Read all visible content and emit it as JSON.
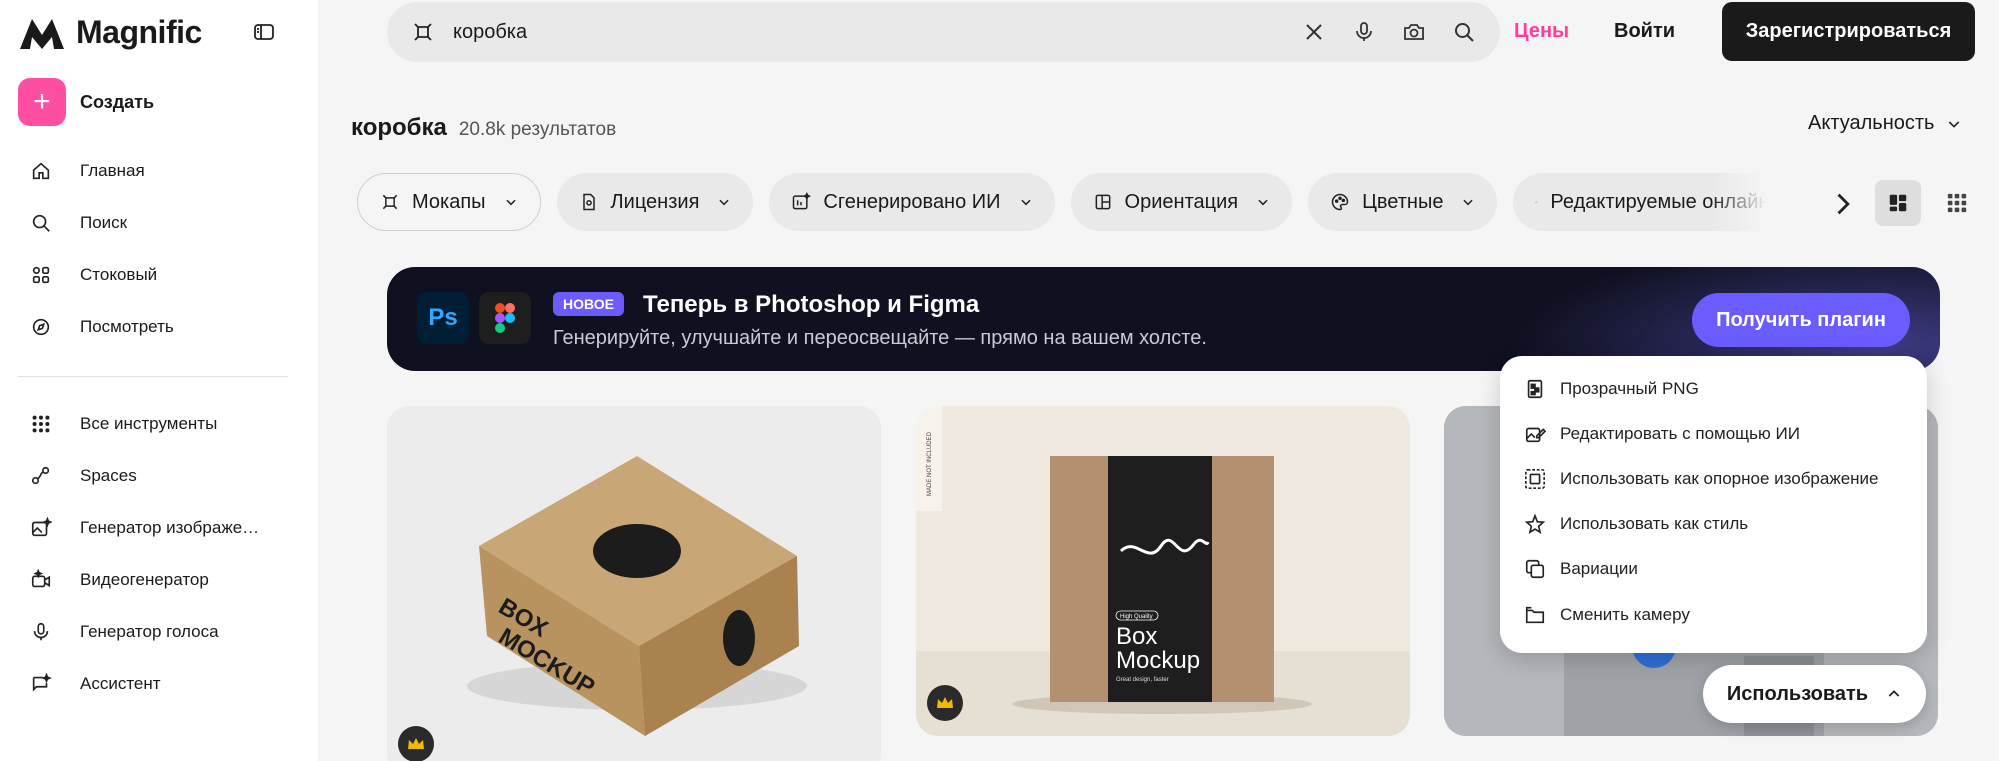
{
  "brand": {
    "name": "Magnific"
  },
  "sidebar": {
    "create_label": "Создать",
    "items_top": [
      {
        "label": "Главная",
        "icon": "home-icon"
      },
      {
        "label": "Поиск",
        "icon": "search-icon"
      },
      {
        "label": "Стоковый",
        "icon": "stock-grid-icon"
      },
      {
        "label": "Посмотреть",
        "icon": "explore-icon"
      }
    ],
    "items_bottom": [
      {
        "label": "Все инструменты",
        "icon": "apps-grid-icon"
      },
      {
        "label": "Spaces",
        "icon": "spaces-icon"
      },
      {
        "label": "Генератор изображе…",
        "icon": "image-generator-icon"
      },
      {
        "label": "Видеогенератор",
        "icon": "video-generator-icon"
      },
      {
        "label": "Генератор голоса",
        "icon": "microphone-icon"
      },
      {
        "label": "Ассистент",
        "icon": "assistant-icon"
      }
    ]
  },
  "search": {
    "value": "коробка"
  },
  "header": {
    "prices": "Цены",
    "login": "Войти",
    "register": "Зарегистрироваться"
  },
  "results": {
    "query": "коробка",
    "count": "20.8k результатов",
    "sort": "Актуальность"
  },
  "filters": [
    {
      "label": "Мокапы",
      "icon": "mockup-icon"
    },
    {
      "label": "Лицензия",
      "icon": "license-icon"
    },
    {
      "label": "Сгенерировано ИИ",
      "icon": "ai-generated-icon"
    },
    {
      "label": "Ориентация",
      "icon": "orientation-icon"
    },
    {
      "label": "Цветные",
      "icon": "palette-icon"
    },
    {
      "label": "Редактируемые онлайн",
      "icon": "brush-icon"
    }
  ],
  "banner": {
    "badge": "НОВОЕ",
    "title": "Теперь в Photoshop и Figma",
    "subtitle": "Генерируйте, улучшайте и переосвещайте — прямо на вашем холсте.",
    "button": "Получить плагин",
    "ps_label": "Ps"
  },
  "cards": [
    {
      "text_top": "BOX",
      "text_bottom": "MOCKUP"
    },
    {
      "tag": "High Quality",
      "title_1": "Box",
      "title_2": "Mockup",
      "caption": "Great design, faster",
      "side_label": "MADE NOT INCLUDED"
    }
  ],
  "menu": {
    "items": [
      {
        "label": "Прозрачный PNG",
        "icon": "transparent-png-icon"
      },
      {
        "label": "Редактировать с помощью ИИ",
        "icon": "ai-edit-icon"
      },
      {
        "label": "Использовать как опорное изображение",
        "icon": "reference-image-icon"
      },
      {
        "label": "Использовать как стиль",
        "icon": "style-star-icon"
      },
      {
        "label": "Вариации",
        "icon": "variations-icon"
      },
      {
        "label": "Сменить камеру",
        "icon": "camera-change-icon"
      }
    ],
    "use_button": "Использовать"
  },
  "colors": {
    "accent_pink": "#ff4fa3",
    "prices_pink": "#ff3d9a",
    "plugin_purple": "#6b5cff",
    "banner_bg": "#0f1020"
  }
}
